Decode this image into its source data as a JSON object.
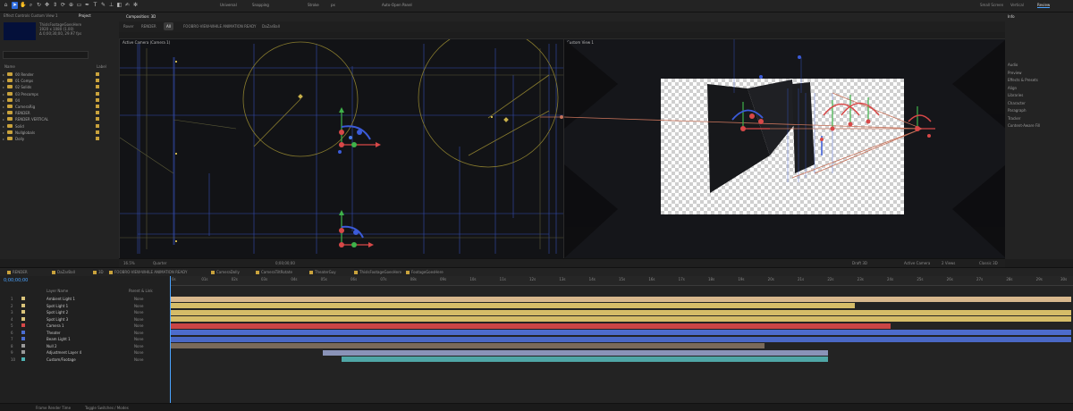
{
  "toolbar": {
    "snapping_label": "Snapping",
    "universal_label": "Universal",
    "stroke_label": "Stroke",
    "px_label": "px",
    "auto_open_label": "Auto-Open Panel",
    "workspaces": [
      "Small Screen",
      "Vertical",
      "Review"
    ],
    "active_workspace": "Review"
  },
  "project_panel": {
    "tabs": [
      "Effect Controls Custom View 1",
      "Project"
    ],
    "active_tab": "Project",
    "item_name": "ThisIsFootageGoesHere",
    "item_info": "1920 x 1080 (1.00)",
    "item_duration": "Δ 0;00;30;00, 29.97 fps",
    "column_header": "Name",
    "type_header": "Label",
    "folders": [
      "00 Render",
      "01 Comps",
      "02 Solids",
      "03 Precomps",
      "04",
      "CameraRig",
      "RENDER",
      "RENDER VERTICAL",
      "Solid",
      "Nullglobals",
      "Dolly"
    ]
  },
  "viewer": {
    "tabs": [
      "Composition: 3D"
    ],
    "breadcrumbs": [
      "Rover",
      "RENDER",
      "All",
      "FOOBRO-VIEW-WHILE ANIMATION READY",
      "DaZarBall"
    ],
    "left_label": "Active Camera (Camera 1)",
    "right_label": "Custom View 1",
    "footer": {
      "zoom": "16.5%",
      "quality": "Quarter",
      "timecode": "0;00;00;00",
      "view_label": "Active Camera",
      "layout_label": "2 Views",
      "draft_label": "Draft 3D",
      "renderer": "Classic 3D",
      "resolution": "Half"
    }
  },
  "right_panel": {
    "title": "Info",
    "items": [
      "Audio",
      "Preview",
      "Effects & Presets",
      "Align",
      "Libraries",
      "Character",
      "Paragraph",
      "Tracker",
      "Content-Aware Fill"
    ]
  },
  "timeline": {
    "tabs": [
      {
        "label": "RENDER",
        "color": "#c9a23c"
      },
      {
        "label": "DaZarBall",
        "color": "#c9a23c"
      },
      {
        "label": "3D",
        "color": "#c9a23c"
      },
      {
        "label": "FOOBRO-VIEW-WHILE ANIMATION READY",
        "color": "#c9a23c"
      },
      {
        "label": "CameraDolly",
        "color": "#c9a23c"
      },
      {
        "label": "CameraTiltRotate",
        "color": "#c9a23c"
      },
      {
        "label": "TheaterGuy",
        "color": "#c9a23c"
      },
      {
        "label": "ThisIsFootageGoesHere",
        "color": "#c9a23c"
      },
      {
        "label": "FootageGoesHere",
        "color": "#c9a23c"
      }
    ],
    "current_time": "0;00;00;00",
    "layer_name_header": "Layer Name",
    "parent_header": "Parent & Link",
    "ruler_ticks": [
      "0s",
      "01s",
      "02s",
      "03s",
      "04s",
      "05s",
      "06s",
      "07s",
      "08s",
      "09s",
      "10s",
      "11s",
      "12s",
      "13s",
      "14s",
      "15s",
      "16s",
      "17s",
      "18s",
      "19s",
      "20s",
      "21s",
      "22s",
      "23s",
      "24s",
      "25s",
      "26s",
      "27s",
      "28s",
      "29s",
      "30s"
    ],
    "layers": [
      {
        "num": "1",
        "name": "Ambient Light 1",
        "label": "#d9c37a",
        "mode": "None",
        "bar": {
          "start": 0,
          "end": 1,
          "color": "#d8b88d"
        }
      },
      {
        "num": "2",
        "name": "Spot Light 1",
        "label": "#d9c37a",
        "mode": "None",
        "bar": {
          "start": 0,
          "end": 0.76,
          "color": "#d5bc68"
        }
      },
      {
        "num": "3",
        "name": "Spot Light 2",
        "label": "#d9c37a",
        "mode": "None",
        "bar": {
          "start": 0,
          "end": 1,
          "color": "#d5bc68"
        }
      },
      {
        "num": "4",
        "name": "Spot Light 3",
        "label": "#d9c37a",
        "mode": "None",
        "bar": {
          "start": 0,
          "end": 1,
          "color": "#d5bc68"
        }
      },
      {
        "num": "5",
        "name": "Camera 1",
        "label": "#d84848",
        "mode": "None",
        "bar": {
          "start": 0,
          "end": 0.8,
          "color": "#c94545"
        }
      },
      {
        "num": "6",
        "name": "Theater",
        "label": "#4a6ed3",
        "mode": "None",
        "bar": {
          "start": 0,
          "end": 1,
          "color": "#4d6ccc"
        }
      },
      {
        "num": "7",
        "name": "Beam Light 1",
        "label": "#4a6ed3",
        "mode": "None",
        "bar": {
          "start": 0,
          "end": 1,
          "color": "#4a68c4"
        }
      },
      {
        "num": "8",
        "name": "Null 2",
        "label": "#9a9a9a",
        "mode": "None",
        "bar": {
          "start": 0,
          "end": 0.66,
          "color": "#7a6a5a"
        }
      },
      {
        "num": "9",
        "name": "Adjustment Layer 4",
        "label": "#9a9a9a",
        "mode": "None",
        "bar": {
          "start": 0.17,
          "end": 0.73,
          "color": "#8a93b8"
        }
      },
      {
        "num": "10",
        "name": "Custom/Footage",
        "label": "#4fb3b3",
        "mode": "None",
        "bar": {
          "start": 0.19,
          "end": 0.73,
          "color": "#4fa6a6"
        }
      }
    ]
  },
  "status_bar": {
    "render_time": "Frame Render Time",
    "toggle": "Toggle Switches / Modes"
  },
  "colors": {
    "accent": "#2d6cdf",
    "gizmo_yellow": "#c8b04a",
    "gizmo_blue": "#3b5bd9"
  }
}
